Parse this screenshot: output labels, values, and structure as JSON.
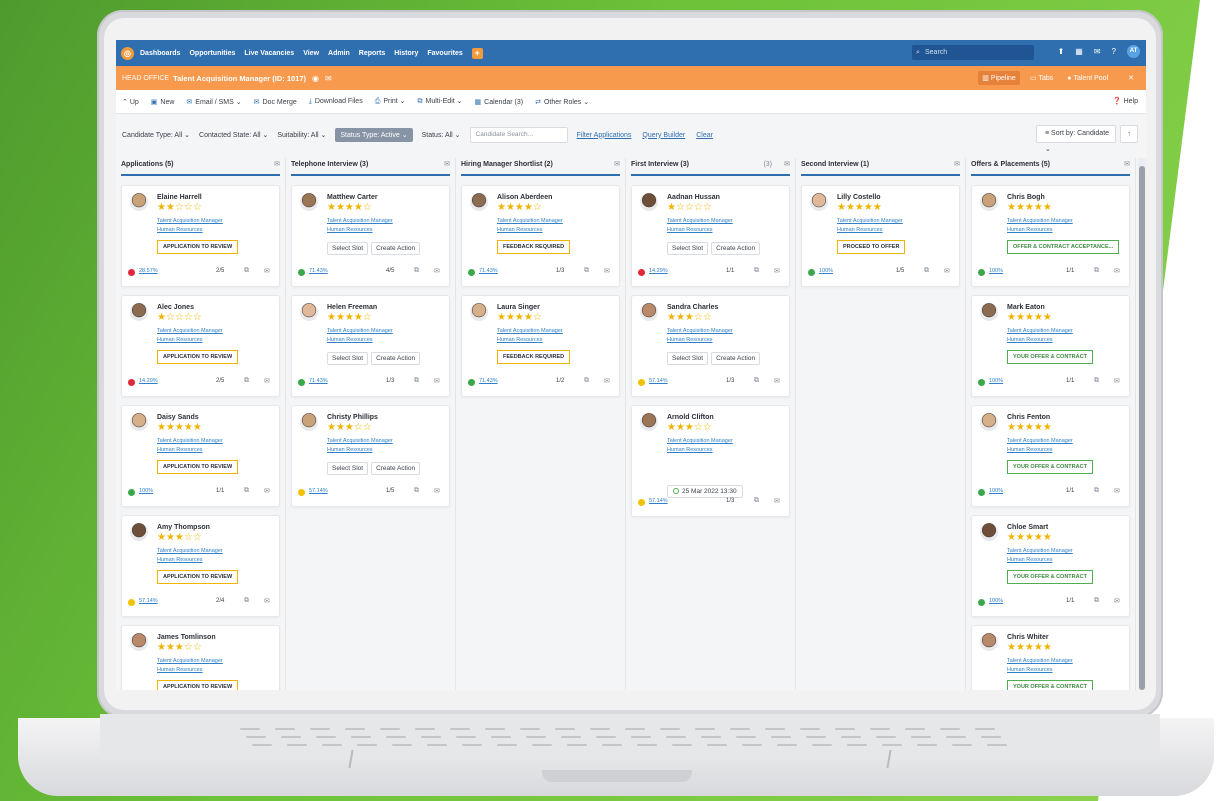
{
  "nav": {
    "items": [
      "Dashboards",
      "Opportunities",
      "Live Vacancies",
      "View",
      "Admin",
      "Reports",
      "History",
      "Favourites"
    ],
    "plus": "+",
    "search_placeholder": "Search",
    "avatar": "AT"
  },
  "context": {
    "office": "HEAD OFFICE",
    "title": "Talent Acquisition Manager (ID: 1017)",
    "pipeline": "Pipeline",
    "tabs": "Tabs",
    "talent_pool": "Talent Pool"
  },
  "toolbar": {
    "up": "Up",
    "new": "New",
    "email": "Email / SMS",
    "doc_merge": "Doc Merge",
    "download": "Download Files",
    "print": "Print",
    "multi_edit": "Multi-Edit",
    "calendar": "Calendar (3)",
    "other_roles": "Other Roles",
    "help": "Help"
  },
  "filters": {
    "candidate_type": "Candidate Type: All",
    "contacted_state": "Contacted State: All",
    "suitability": "Suitability: All",
    "status_type": "Status Type: Active",
    "status": "Status: All",
    "search_placeholder": "Candidate Search...",
    "filter_applications": "Filter Applications",
    "query_builder": "Query Builder",
    "clear": "Clear",
    "sort": "Sort by: Candidate"
  },
  "job": {
    "line1": "Talent Acquisition Manager",
    "line2": "Human Resources"
  },
  "btn": {
    "select_slot": "Select Slot",
    "create_action": "Create Action"
  },
  "columns": [
    {
      "title": "Applications (5)",
      "cards": [
        {
          "name": "Elaine Harrell",
          "stars": "★★☆☆☆",
          "tag": "APPLICATION TO REVIEW",
          "pct": "28.57%",
          "count": "2/5",
          "dot": "#e0283a"
        },
        {
          "name": "Alec Jones",
          "stars": "★☆☆☆☆",
          "tag": "APPLICATION TO REVIEW",
          "pct": "14.29%",
          "count": "2/5",
          "dot": "#e0283a"
        },
        {
          "name": "Daisy Sands",
          "stars": "★★★★★",
          "tag": "APPLICATION TO REVIEW",
          "pct": "100%",
          "count": "1/1",
          "dot": "#3aa84a"
        },
        {
          "name": "Amy Thompson",
          "stars": "★★★☆☆",
          "tag": "APPLICATION TO REVIEW",
          "pct": "57.14%",
          "count": "2/4",
          "dot": "#f2c200"
        },
        {
          "name": "James Tomlinson",
          "stars": "★★★☆☆",
          "tag": "APPLICATION TO REVIEW"
        }
      ]
    },
    {
      "title": "Telephone Interview (3)",
      "cards": [
        {
          "name": "Matthew Carter",
          "stars": "★★★★☆",
          "pct": "71.43%",
          "count": "4/5",
          "dot": "#3aa84a"
        },
        {
          "name": "Helen Freeman",
          "stars": "★★★★☆",
          "pct": "71.43%",
          "count": "1/3",
          "dot": "#3aa84a"
        },
        {
          "name": "Christy Phillips",
          "stars": "★★★☆☆",
          "pct": "57.14%",
          "count": "1/5",
          "dot": "#f2c200"
        }
      ]
    },
    {
      "title": "Hiring Manager Shortlist (2)",
      "cards": [
        {
          "name": "Alison Aberdeen",
          "stars": "★★★★☆",
          "tag": "FEEDBACK REQUIRED",
          "pct": "71.43%",
          "count": "1/3",
          "dot": "#3aa84a"
        },
        {
          "name": "Laura Singer",
          "stars": "★★★★☆",
          "tag": "FEEDBACK REQUIRED",
          "pct": "71.43%",
          "count": "1/2",
          "dot": "#3aa84a"
        }
      ]
    },
    {
      "title": "First Interview (3)",
      "count_icon": "(3)",
      "cards": [
        {
          "name": "Aadnan Hussan",
          "stars": "★☆☆☆☆",
          "pct": "14.29%",
          "count": "1/1",
          "dot": "#e0283a"
        },
        {
          "name": "Sandra Charles",
          "stars": "★★★☆☆",
          "pct": "57.14%",
          "count": "1/3",
          "dot": "#f2c200"
        },
        {
          "name": "Arnold Clifton",
          "stars": "★★★☆☆",
          "date": "25 Mar 2022 13:30",
          "pct": "57.14%",
          "count": "1/3",
          "dot": "#f2c200"
        }
      ]
    },
    {
      "title": "Second Interview (1)",
      "cards": [
        {
          "name": "Lilly Costello",
          "stars": "★★★★★",
          "tag": "PROCEED TO OFFER",
          "pct": "100%",
          "count": "1/5",
          "dot": "#3aa84a"
        }
      ]
    },
    {
      "title": "Offers & Placements (5)",
      "cards": [
        {
          "name": "Chris Bogh",
          "stars": "★★★★★",
          "tag": "OFFER & CONTRACT ACCEPTANCE...",
          "pct": "100%",
          "count": "1/1",
          "dot": "#3aa84a"
        },
        {
          "name": "Mark Eaton",
          "stars": "★★★★★",
          "tag": "YOUR OFFER & CONTRACT",
          "pct": "100%",
          "count": "1/1",
          "dot": "#3aa84a"
        },
        {
          "name": "Chris Fenton",
          "stars": "★★★★★",
          "tag": "YOUR OFFER & CONTRACT",
          "pct": "100%",
          "count": "1/1",
          "dot": "#3aa84a"
        },
        {
          "name": "Chloe Smart",
          "stars": "★★★★★",
          "tag": "YOUR OFFER & CONTRACT",
          "pct": "100%",
          "count": "1/1",
          "dot": "#3aa84a"
        },
        {
          "name": "Chris Whiter",
          "stars": "★★★★★",
          "tag": "YOUR OFFER & CONTRACT"
        }
      ]
    }
  ],
  "colors": {
    "accent": "#2f6fb0",
    "orange": "#f79a4e",
    "green_bg": "#6cc238",
    "star": "#f0b400"
  }
}
